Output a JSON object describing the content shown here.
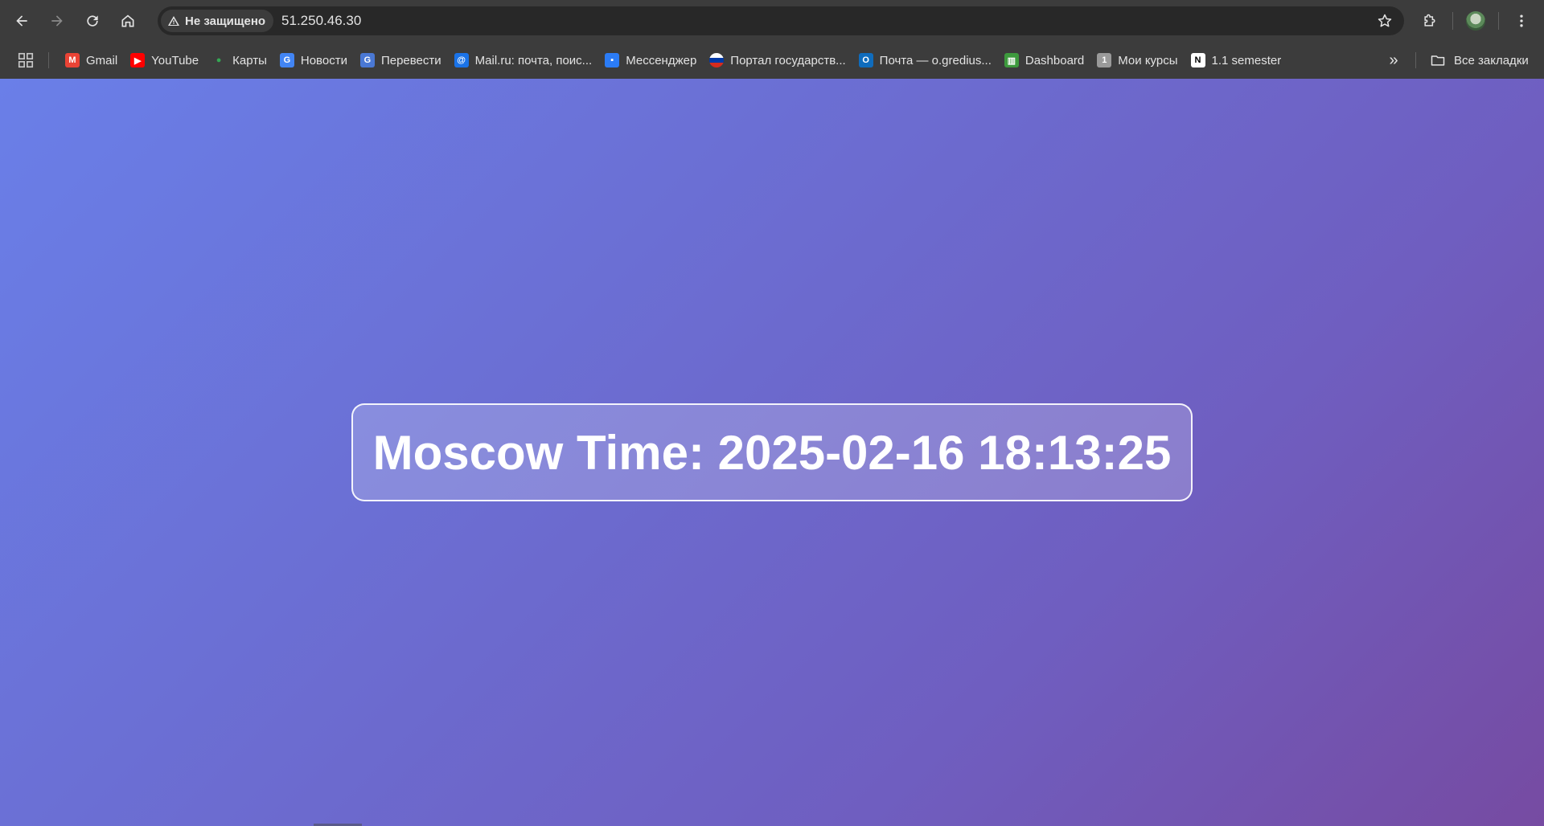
{
  "browser": {
    "security_label": "Не защищено",
    "url": "51.250.46.30",
    "icons": {
      "back": "back-arrow-icon",
      "forward": "forward-arrow-icon",
      "reload": "reload-icon",
      "home": "home-icon",
      "warning": "warning-triangle-icon",
      "star": "star-icon",
      "extensions": "puzzle-icon",
      "menu": "kebab-menu-icon"
    }
  },
  "bookmarks": {
    "items": [
      {
        "label": "Gmail",
        "icon": "gmail-icon",
        "color": "#ea4335",
        "glyph": "M"
      },
      {
        "label": "YouTube",
        "icon": "youtube-icon",
        "color": "#ff0000",
        "glyph": "▶"
      },
      {
        "label": "Карты",
        "icon": "maps-pin-icon",
        "color": "#34a853",
        "glyph": "●"
      },
      {
        "label": "Новости",
        "icon": "news-icon",
        "color": "#4285f4",
        "glyph": "G"
      },
      {
        "label": "Перевести",
        "icon": "translate-icon",
        "color": "#4a78d4",
        "glyph": "G"
      },
      {
        "label": "Mail.ru: почта, поис...",
        "icon": "at-sign-icon",
        "color": "#1a73e8",
        "glyph": "@"
      },
      {
        "label": "Мессенджер",
        "icon": "messenger-icon",
        "color": "#2b7cf6",
        "glyph": "▪"
      },
      {
        "label": "Портал государств...",
        "icon": "gosuslugi-icon",
        "color": "#d52b1e",
        "glyph": ""
      },
      {
        "label": "Почта — o.gredius...",
        "icon": "outlook-icon",
        "color": "#0f6cbd",
        "glyph": "O"
      },
      {
        "label": "Dashboard",
        "icon": "dashboard-icon",
        "color": "#3d9a3d",
        "glyph": "▥"
      },
      {
        "label": "Мои курсы",
        "icon": "courses-icon",
        "color": "#9a9a9a",
        "glyph": "1"
      },
      {
        "label": "1.1 semester",
        "icon": "notion-icon",
        "color": "#ffffff",
        "glyph": "N"
      }
    ],
    "all_bookmarks_label": "Все закладки"
  },
  "page": {
    "time_text": "Moscow Time: 2025-02-16 18:13:25",
    "gradient": [
      "#667eea",
      "#764ba2"
    ]
  }
}
